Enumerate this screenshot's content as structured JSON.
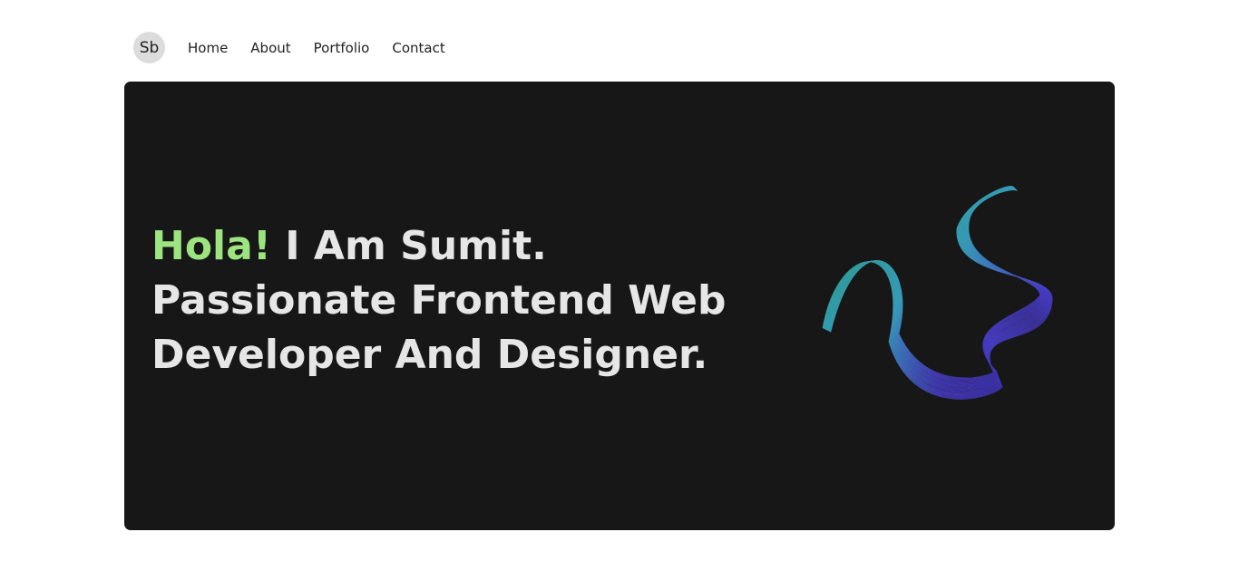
{
  "brand": {
    "logo_text": "Sb"
  },
  "nav": {
    "items": [
      {
        "label": "Home"
      },
      {
        "label": "About"
      },
      {
        "label": "Portfolio"
      },
      {
        "label": "Contact"
      }
    ]
  },
  "hero": {
    "greeting": "Hola!",
    "headline_rest": " I Am Sumit. Passionate Frontend Web Developer And Designer.",
    "accent_color": "#9be47f",
    "text_color": "#e6e6e6",
    "background_color": "#171717",
    "art_icon": "abstract-wave-icon"
  }
}
